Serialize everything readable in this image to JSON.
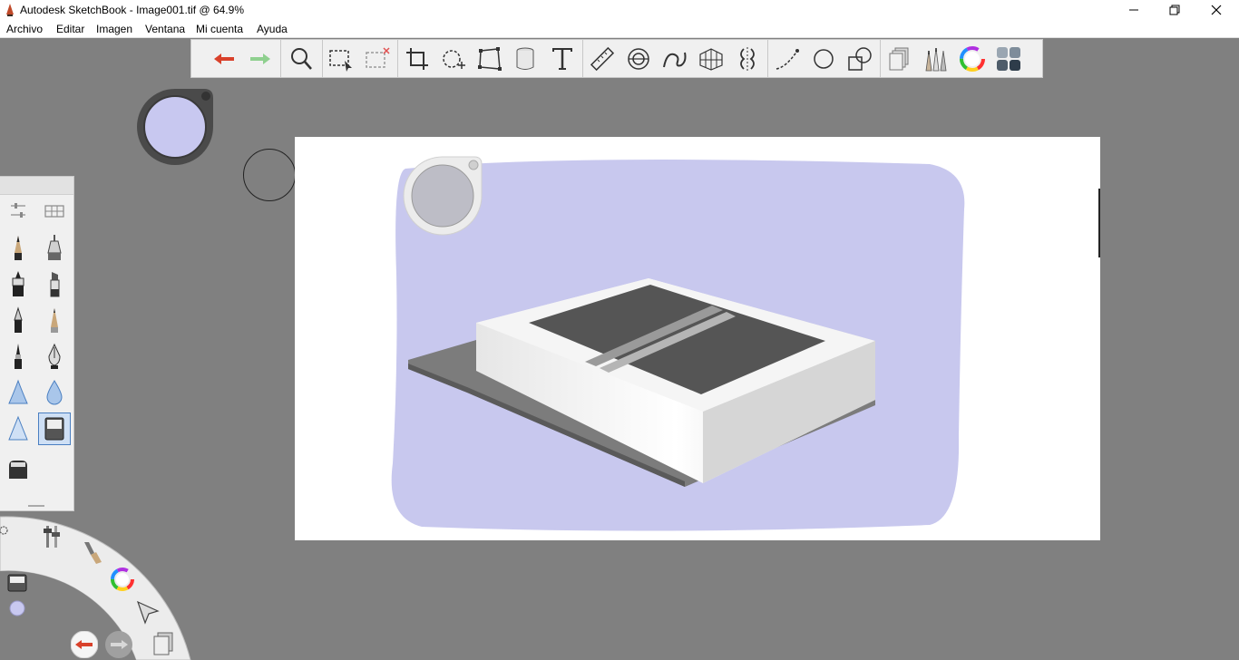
{
  "window": {
    "title": "Autodesk SketchBook - Image001.tif @ 64.9%",
    "minimize_icon": "minimize-icon",
    "maximize_icon": "restore-icon",
    "close_icon": "close-icon"
  },
  "menu": {
    "items": [
      {
        "label": "Archivo"
      },
      {
        "label": "Editar"
      },
      {
        "label": "Imagen"
      },
      {
        "label": "Ventana"
      },
      {
        "label": "Mi cuenta"
      },
      {
        "label": "Ayuda"
      }
    ]
  },
  "toolbar": {
    "tools": [
      {
        "icon": "undo-icon"
      },
      {
        "icon": "redo-icon"
      },
      {
        "icon": "zoom-icon"
      },
      {
        "icon": "select-icon"
      },
      {
        "icon": "clear-selection-icon"
      },
      {
        "icon": "crop-icon"
      },
      {
        "icon": "transform-icon"
      },
      {
        "icon": "distort-icon"
      },
      {
        "icon": "fill-icon"
      },
      {
        "icon": "text-icon"
      },
      {
        "icon": "ruler-icon"
      },
      {
        "icon": "ellipse-guide-icon"
      },
      {
        "icon": "french-curve-icon"
      },
      {
        "icon": "perspective-icon"
      },
      {
        "icon": "symmetry-icon"
      },
      {
        "icon": "line-icon"
      },
      {
        "icon": "circle-icon"
      },
      {
        "icon": "shapes-icon"
      },
      {
        "icon": "layers-icon"
      },
      {
        "icon": "brushes-icon"
      },
      {
        "icon": "color-wheel-icon"
      },
      {
        "icon": "copic-library-icon"
      }
    ]
  },
  "colors": {
    "background": "#808080",
    "current_color": "#c8c8f0",
    "canvas_wash": "#c8c8ee",
    "undo_red": "#d9412b",
    "redo_green": "#8fd08f"
  },
  "brush_palette": {
    "selected": "airbrush-marker",
    "brushes": [
      "pencil",
      "technical-pen",
      "ink-pen",
      "marker",
      "ballpoint",
      "felt-pen",
      "brush-pen",
      "calligraphy-pen",
      "airbrush",
      "watercolor",
      "hard-eraser",
      "airbrush-marker",
      "soft-eraser"
    ]
  },
  "lagoon": {
    "items": [
      "brush-properties-icon",
      "brush-library-icon",
      "color-editor-icon",
      "select-arrow-icon",
      "layer-icon",
      "undo-icon",
      "redo-icon"
    ]
  }
}
